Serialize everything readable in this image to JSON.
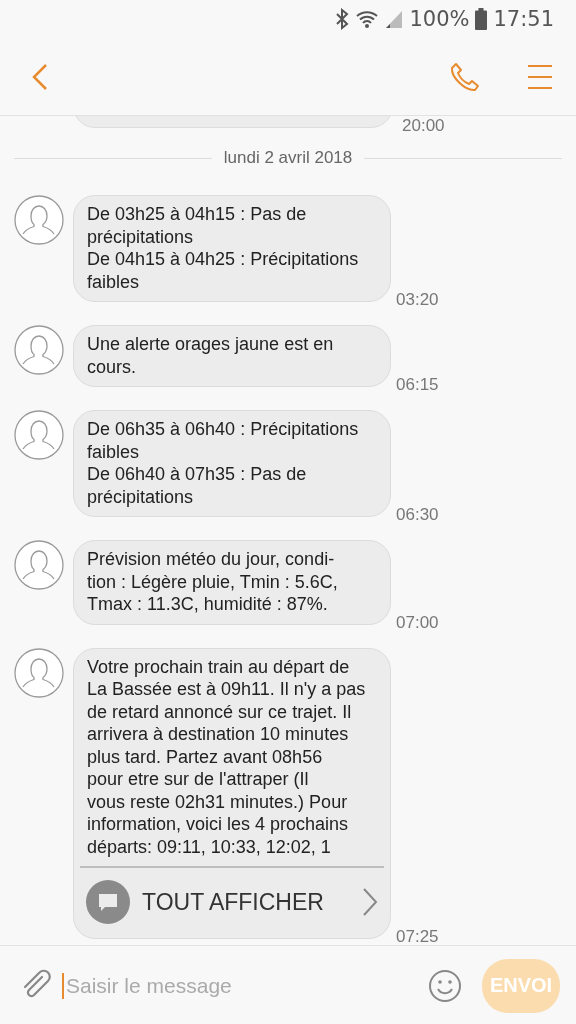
{
  "status_bar": {
    "battery": "100%",
    "time": "17:51"
  },
  "partial_message": {
    "time": "20:00"
  },
  "date_separator": "lundi 2 avril 2018",
  "messages": [
    {
      "text": "De 03h25 à 04h15 : Pas de\nprécipitations\nDe 04h15 à 04h25 : Précipitations\nfaibles",
      "time": "03:20"
    },
    {
      "text": "Une alerte orages jaune est en\ncours.",
      "time": "06:15"
    },
    {
      "text": "De 06h35 à 06h40 : Précipitations\nfaibles\nDe 06h40 à 07h35 : Pas de\nprécipitations",
      "time": "06:30"
    },
    {
      "text": "Prévision météo du jour, condi-\ntion : Légère pluie, Tmin : 5.6C,\nTmax : 11.3C, humidité : 87%.",
      "time": "07:00"
    },
    {
      "text": "Votre prochain train au départ de\nLa Bassée est à 09h11. Il n'y a pas\nde retard annoncé sur ce trajet. Il\narrivera à destination 10 minutes\nplus tard. Partez avant 08h56\npour etre sur de l'attraper (Il\nvous reste 02h31 minutes.) Pour\ninformation, voici les 4 prochains\ndéparts: 09:11, 10:33, 12:02, 1",
      "time": "07:25",
      "show_all": "TOUT AFFICHER"
    }
  ],
  "composer": {
    "placeholder": "Saisir le message",
    "send": "ENVOI",
    "send_disabled": true
  }
}
